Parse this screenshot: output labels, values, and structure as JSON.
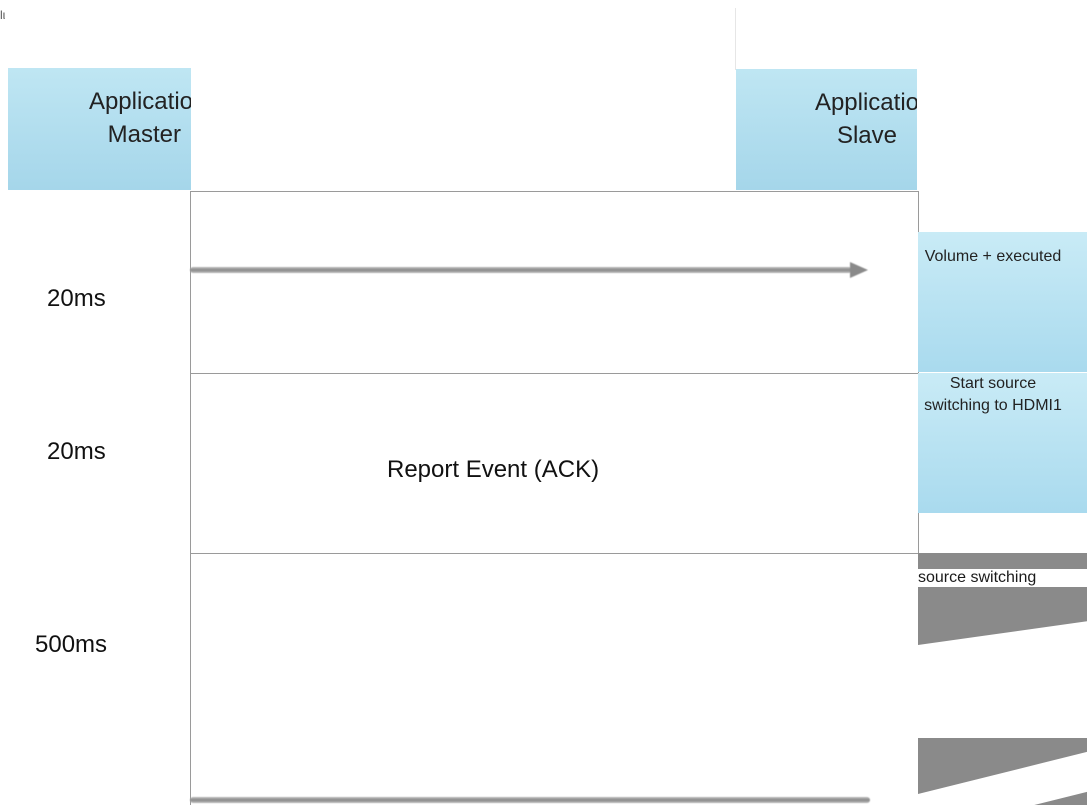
{
  "corner_text": "lι",
  "master": {
    "line1": "Applicatio",
    "line2": "Master"
  },
  "slave": {
    "line1": "Applicatio",
    "line2": "Slave"
  },
  "timings": [
    "20ms",
    "20ms",
    "500ms"
  ],
  "report_event": "Report Event (ACK)",
  "side_boxes": [
    {
      "text": "Volume + executed"
    },
    {
      "text": "Start source switching to HDMI1"
    }
  ],
  "source_switching": "source switching",
  "colors": {
    "header_fill": "#b3def0",
    "side_fill": "#b9e2f2",
    "frame_border": "#9a9a9a",
    "arrow": "#8a8a8a",
    "shadow": "#8a8a8a"
  }
}
